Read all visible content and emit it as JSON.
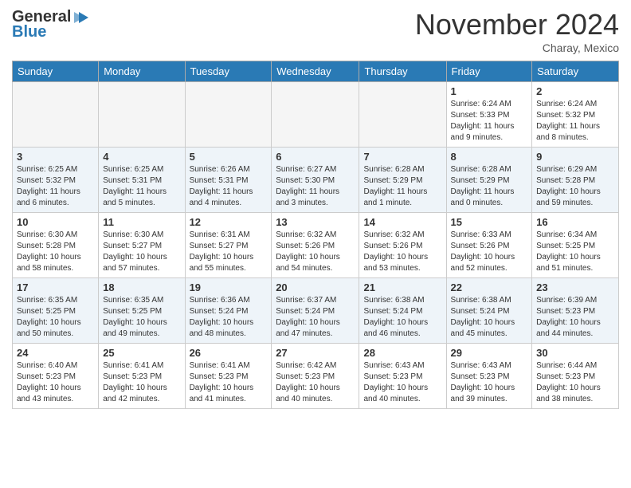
{
  "header": {
    "logo_general": "General",
    "logo_blue": "Blue",
    "month_title": "November 2024",
    "subtitle": "Charay, Mexico"
  },
  "days_of_week": [
    "Sunday",
    "Monday",
    "Tuesday",
    "Wednesday",
    "Thursday",
    "Friday",
    "Saturday"
  ],
  "weeks": [
    {
      "alt": false,
      "days": [
        {
          "num": "",
          "info": ""
        },
        {
          "num": "",
          "info": ""
        },
        {
          "num": "",
          "info": ""
        },
        {
          "num": "",
          "info": ""
        },
        {
          "num": "",
          "info": ""
        },
        {
          "num": "1",
          "info": "Sunrise: 6:24 AM\nSunset: 5:33 PM\nDaylight: 11 hours\nand 9 minutes."
        },
        {
          "num": "2",
          "info": "Sunrise: 6:24 AM\nSunset: 5:32 PM\nDaylight: 11 hours\nand 8 minutes."
        }
      ]
    },
    {
      "alt": true,
      "days": [
        {
          "num": "3",
          "info": "Sunrise: 6:25 AM\nSunset: 5:32 PM\nDaylight: 11 hours\nand 6 minutes."
        },
        {
          "num": "4",
          "info": "Sunrise: 6:25 AM\nSunset: 5:31 PM\nDaylight: 11 hours\nand 5 minutes."
        },
        {
          "num": "5",
          "info": "Sunrise: 6:26 AM\nSunset: 5:31 PM\nDaylight: 11 hours\nand 4 minutes."
        },
        {
          "num": "6",
          "info": "Sunrise: 6:27 AM\nSunset: 5:30 PM\nDaylight: 11 hours\nand 3 minutes."
        },
        {
          "num": "7",
          "info": "Sunrise: 6:28 AM\nSunset: 5:29 PM\nDaylight: 11 hours\nand 1 minute."
        },
        {
          "num": "8",
          "info": "Sunrise: 6:28 AM\nSunset: 5:29 PM\nDaylight: 11 hours\nand 0 minutes."
        },
        {
          "num": "9",
          "info": "Sunrise: 6:29 AM\nSunset: 5:28 PM\nDaylight: 10 hours\nand 59 minutes."
        }
      ]
    },
    {
      "alt": false,
      "days": [
        {
          "num": "10",
          "info": "Sunrise: 6:30 AM\nSunset: 5:28 PM\nDaylight: 10 hours\nand 58 minutes."
        },
        {
          "num": "11",
          "info": "Sunrise: 6:30 AM\nSunset: 5:27 PM\nDaylight: 10 hours\nand 57 minutes."
        },
        {
          "num": "12",
          "info": "Sunrise: 6:31 AM\nSunset: 5:27 PM\nDaylight: 10 hours\nand 55 minutes."
        },
        {
          "num": "13",
          "info": "Sunrise: 6:32 AM\nSunset: 5:26 PM\nDaylight: 10 hours\nand 54 minutes."
        },
        {
          "num": "14",
          "info": "Sunrise: 6:32 AM\nSunset: 5:26 PM\nDaylight: 10 hours\nand 53 minutes."
        },
        {
          "num": "15",
          "info": "Sunrise: 6:33 AM\nSunset: 5:26 PM\nDaylight: 10 hours\nand 52 minutes."
        },
        {
          "num": "16",
          "info": "Sunrise: 6:34 AM\nSunset: 5:25 PM\nDaylight: 10 hours\nand 51 minutes."
        }
      ]
    },
    {
      "alt": true,
      "days": [
        {
          "num": "17",
          "info": "Sunrise: 6:35 AM\nSunset: 5:25 PM\nDaylight: 10 hours\nand 50 minutes."
        },
        {
          "num": "18",
          "info": "Sunrise: 6:35 AM\nSunset: 5:25 PM\nDaylight: 10 hours\nand 49 minutes."
        },
        {
          "num": "19",
          "info": "Sunrise: 6:36 AM\nSunset: 5:24 PM\nDaylight: 10 hours\nand 48 minutes."
        },
        {
          "num": "20",
          "info": "Sunrise: 6:37 AM\nSunset: 5:24 PM\nDaylight: 10 hours\nand 47 minutes."
        },
        {
          "num": "21",
          "info": "Sunrise: 6:38 AM\nSunset: 5:24 PM\nDaylight: 10 hours\nand 46 minutes."
        },
        {
          "num": "22",
          "info": "Sunrise: 6:38 AM\nSunset: 5:24 PM\nDaylight: 10 hours\nand 45 minutes."
        },
        {
          "num": "23",
          "info": "Sunrise: 6:39 AM\nSunset: 5:23 PM\nDaylight: 10 hours\nand 44 minutes."
        }
      ]
    },
    {
      "alt": false,
      "days": [
        {
          "num": "24",
          "info": "Sunrise: 6:40 AM\nSunset: 5:23 PM\nDaylight: 10 hours\nand 43 minutes."
        },
        {
          "num": "25",
          "info": "Sunrise: 6:41 AM\nSunset: 5:23 PM\nDaylight: 10 hours\nand 42 minutes."
        },
        {
          "num": "26",
          "info": "Sunrise: 6:41 AM\nSunset: 5:23 PM\nDaylight: 10 hours\nand 41 minutes."
        },
        {
          "num": "27",
          "info": "Sunrise: 6:42 AM\nSunset: 5:23 PM\nDaylight: 10 hours\nand 40 minutes."
        },
        {
          "num": "28",
          "info": "Sunrise: 6:43 AM\nSunset: 5:23 PM\nDaylight: 10 hours\nand 40 minutes."
        },
        {
          "num": "29",
          "info": "Sunrise: 6:43 AM\nSunset: 5:23 PM\nDaylight: 10 hours\nand 39 minutes."
        },
        {
          "num": "30",
          "info": "Sunrise: 6:44 AM\nSunset: 5:23 PM\nDaylight: 10 hours\nand 38 minutes."
        }
      ]
    }
  ]
}
